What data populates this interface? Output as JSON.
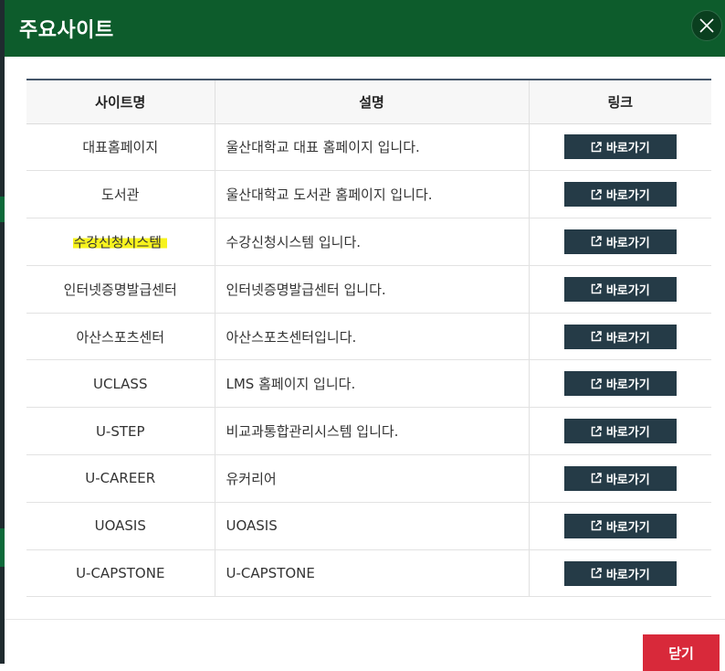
{
  "modal": {
    "title": "주요사이트",
    "close_label": "닫기"
  },
  "table": {
    "headers": [
      "사이트명",
      "설명",
      "링크"
    ],
    "rows": [
      {
        "name": "대표홈페이지",
        "description": "울산대학교 대표 홈페이지 입니다.",
        "link_label": "바로가기"
      },
      {
        "name": "도서관",
        "description": "울산대학교 도서관 홈페이지 입니다.",
        "link_label": "바로가기"
      },
      {
        "name": "수강신청시스템",
        "description": "수강신청시스템 입니다.",
        "link_label": "바로가기",
        "highlighted": true
      },
      {
        "name": "인터넷증명발급센터",
        "description": "인터넷증명발급센터 입니다.",
        "link_label": "바로가기"
      },
      {
        "name": "아산스포츠센터",
        "description": "아산스포츠센터입니다.",
        "link_label": "바로가기"
      },
      {
        "name": "UCLASS",
        "description": "LMS 홈페이지 입니다.",
        "link_label": "바로가기"
      },
      {
        "name": "U-STEP",
        "description": "비교과통합관리시스템 입니다.",
        "link_label": "바로가기"
      },
      {
        "name": "U-CAREER",
        "description": "유커리어",
        "link_label": "바로가기"
      },
      {
        "name": "UOASIS",
        "description": "UOASIS",
        "link_label": "바로가기"
      },
      {
        "name": "U-CAPSTONE",
        "description": "U-CAPSTONE",
        "link_label": "바로가기"
      }
    ]
  },
  "colors": {
    "header_bg": "#0d5c2c",
    "button_bg": "#253b47",
    "close_button_bg": "#d8293a",
    "highlight": "#f7f31e"
  },
  "icons": {
    "close": "close-icon",
    "external_link": "external-link-icon"
  }
}
